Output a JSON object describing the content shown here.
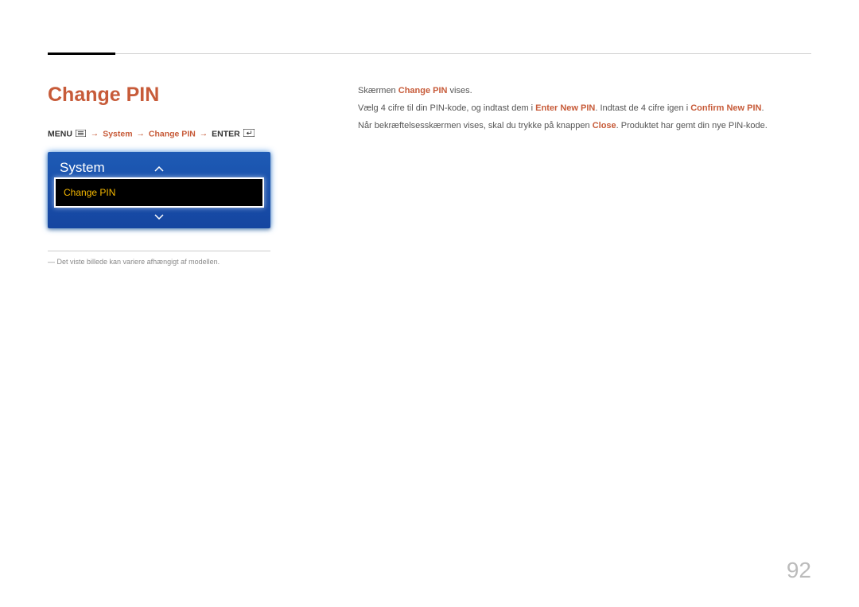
{
  "page": {
    "title": "Change PIN",
    "number": "92"
  },
  "breadcrumb": {
    "menu_label": "MENU",
    "system_label": "System",
    "changepin_label": "Change PIN",
    "enter_label": "ENTER",
    "arrow": "→"
  },
  "osd": {
    "panel_title": "System",
    "selected_item": "Change PIN"
  },
  "footnote": {
    "prefix": "―",
    "text": "Det viste billede kan variere afhængigt af modellen."
  },
  "body_text": {
    "line1_a": "Skærmen ",
    "line1_b": "Change PIN",
    "line1_c": " vises.",
    "line2_a": "Vælg 4 cifre til din PIN-kode, og indtast dem i ",
    "line2_b": "Enter New PIN",
    "line2_c": ". Indtast de 4 cifre igen i ",
    "line2_d": "Confirm New PIN",
    "line2_e": ".",
    "line3_a": "Når bekræftelsesskærmen vises, skal du trykke på knappen ",
    "line3_b": "Close",
    "line3_c": ". Produktet har gemt din nye PIN-kode."
  }
}
